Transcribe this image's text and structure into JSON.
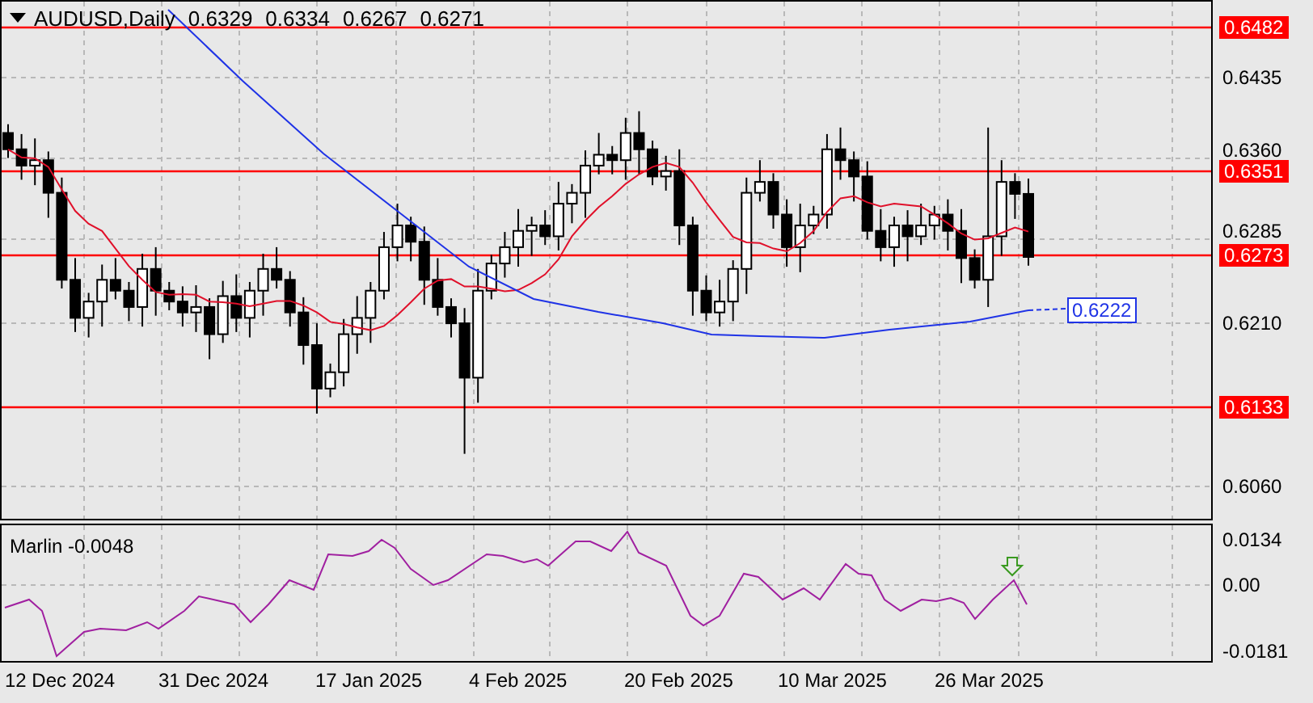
{
  "header": {
    "symbol": "AUDUSD,Daily",
    "ohlc": [
      "0.6329",
      "0.6334",
      "0.6267",
      "0.6271"
    ]
  },
  "price_axis": [
    {
      "label": "0.6482",
      "kind": "level"
    },
    {
      "label": "0.6435",
      "kind": "tick"
    },
    {
      "label": "0.6360",
      "kind": "tick"
    },
    {
      "label": "0.6351",
      "kind": "level"
    },
    {
      "label": "0.6285",
      "kind": "tick"
    },
    {
      "label": "0.6273",
      "kind": "level"
    },
    {
      "label": "0.6210",
      "kind": "tick"
    },
    {
      "label": "0.6133",
      "kind": "level"
    },
    {
      "label": "0.6060",
      "kind": "tick"
    }
  ],
  "ma_label": "0.6222",
  "indicator": {
    "name": "Marlin",
    "value": "-0.0048",
    "axis": [
      "0.0134",
      "0.00",
      "-0.0181"
    ]
  },
  "x_axis": [
    "12 Dec 2024",
    "31 Dec 2024",
    "17 Jan 2025",
    "4 Feb 2025",
    "20 Feb 2025",
    "10 Mar 2025",
    "26 Mar 2025"
  ]
}
